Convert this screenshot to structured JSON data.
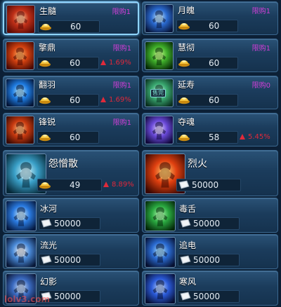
{
  "items": [
    {
      "name": "生髓",
      "limit": "限购1",
      "price": "60",
      "change": "",
      "selected": true,
      "currency_icon": "gold-ingot-icon",
      "icon": "regen-body-icon",
      "colors": [
        "#c03018",
        "#5a0a05",
        "#ffd0a0"
      ]
    },
    {
      "name": "月魄",
      "limit": "限购1",
      "price": "60",
      "change": "",
      "selected": false,
      "currency_icon": "gold-ingot-icon",
      "icon": "spirit-body-icon",
      "colors": [
        "#2a6ad0",
        "#08163a",
        "#c8ecff"
      ]
    },
    {
      "name": "擎鼎",
      "limit": "限购1",
      "price": "60",
      "change": "1.69%",
      "selected": false,
      "currency_icon": "gold-ingot-icon",
      "icon": "lift-cauldron-icon",
      "colors": [
        "#d04010",
        "#4a0a02",
        "#ffb060"
      ]
    },
    {
      "name": "慧彻",
      "limit": "限购1",
      "price": "60",
      "change": "",
      "selected": false,
      "currency_icon": "gold-ingot-icon",
      "icon": "insight-head-icon",
      "colors": [
        "#3fae2a",
        "#062a06",
        "#c8ff8a"
      ]
    },
    {
      "name": "翻羽",
      "limit": "限购1",
      "price": "60",
      "change": "1.69%",
      "selected": false,
      "currency_icon": "gold-ingot-icon",
      "icon": "dash-runner-icon",
      "colors": [
        "#1e7adf",
        "#041638",
        "#aee6ff"
      ]
    },
    {
      "name": "延寿",
      "limit": "限购0",
      "price": "60",
      "change": "",
      "selected": false,
      "currency_icon": "gold-ingot-icon",
      "icon": "longevity-icon",
      "badge": "售完",
      "colors": [
        "#3aa870",
        "#0a3020",
        "#c8ffe8"
      ]
    },
    {
      "name": "锋锐",
      "limit": "限购1",
      "price": "60",
      "change": "",
      "selected": false,
      "currency_icon": "gold-ingot-icon",
      "icon": "fist-icon",
      "colors": [
        "#c83a10",
        "#3a0a02",
        "#ffc080"
      ]
    },
    {
      "name": "夺魂",
      "limit": "",
      "price": "58",
      "change": "5.45%",
      "selected": false,
      "currency_icon": "gold-ingot-icon",
      "icon": "soul-blade-icon",
      "colors": [
        "#6a4ad8",
        "#10083a",
        "#e8d8ff"
      ]
    },
    {
      "name": "怨憎散",
      "limit": "",
      "price": "49",
      "change": "8.89%",
      "selected": false,
      "currency_icon": "gold-ingot-icon",
      "icon": "ghost-icon",
      "colors": [
        "#3aa0c8",
        "#062838",
        "#d8f8ff"
      ]
    },
    {
      "name": "烈火",
      "limit": "",
      "price": "50000",
      "change": "",
      "selected": false,
      "currency_icon": "silver-ticket-icon",
      "icon": "fire-hand-icon",
      "colors": [
        "#e04010",
        "#3a0800",
        "#ffd070"
      ]
    },
    {
      "name": "冰河",
      "limit": "",
      "price": "50000",
      "change": "",
      "selected": false,
      "currency_icon": "silver-ticket-icon",
      "icon": "ice-claw-icon",
      "colors": [
        "#2a7ae0",
        "#061a40",
        "#d0f0ff"
      ]
    },
    {
      "name": "毒舌",
      "limit": "",
      "price": "50000",
      "change": "",
      "selected": false,
      "currency_icon": "silver-ticket-icon",
      "icon": "poison-swirl-icon",
      "colors": [
        "#2aa840",
        "#04280a",
        "#b0ffb0"
      ]
    },
    {
      "name": "流光",
      "limit": "",
      "price": "50000",
      "change": "",
      "selected": false,
      "currency_icon": "silver-ticket-icon",
      "icon": "light-flow-icon",
      "colors": [
        "#4a8ad8",
        "#081838",
        "#ffffff"
      ]
    },
    {
      "name": "追电",
      "limit": "",
      "price": "50000",
      "change": "",
      "selected": false,
      "currency_icon": "silver-ticket-icon",
      "icon": "lightning-chase-icon",
      "colors": [
        "#2a6ad0",
        "#061030",
        "#a8e0ff"
      ]
    },
    {
      "name": "幻影",
      "limit": "",
      "price": "50000",
      "change": "",
      "selected": false,
      "currency_icon": "silver-ticket-icon",
      "icon": "phantom-icon",
      "colors": [
        "#3a6ac0",
        "#0a1430",
        "#d0e4ff"
      ]
    },
    {
      "name": "寒风",
      "limit": "",
      "price": "50000",
      "change": "",
      "selected": false,
      "currency_icon": "silver-ticket-icon",
      "icon": "cold-wind-icon",
      "colors": [
        "#2a5ad8",
        "#060e30",
        "#c0d8ff"
      ]
    }
  ],
  "watermark": "lolv3.com"
}
